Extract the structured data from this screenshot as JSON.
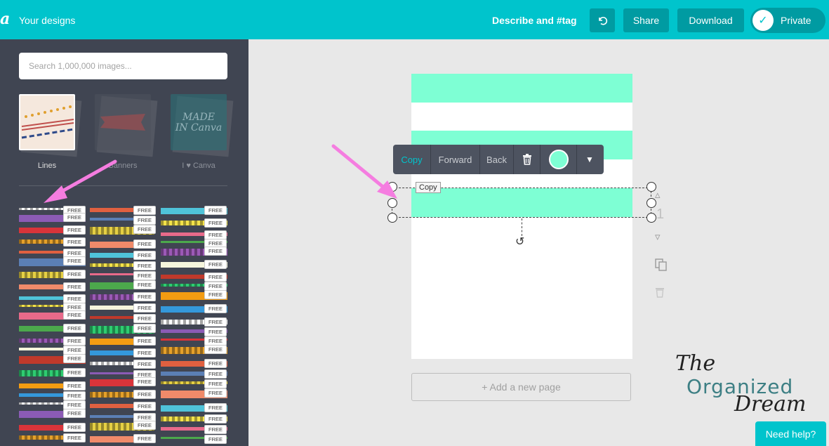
{
  "colors": {
    "brand": "#00c4cc",
    "sidebar": "#404552",
    "accent_shape": "#7effd4",
    "arrow": "#f57de0"
  },
  "header": {
    "logo": "a",
    "your_designs": "Your designs",
    "describe": "Describe and #tag",
    "undo_icon": "undo-icon",
    "share": "Share",
    "download": "Download",
    "private": "Private"
  },
  "sidebar": {
    "search_placeholder": "Search 1,000,000 images...",
    "categories": [
      {
        "label": "Lines",
        "active": true
      },
      {
        "label": "Banners",
        "active": false
      },
      {
        "label": "I ♥ Canva",
        "active": false
      }
    ],
    "canva_thumb": "MADE IN Canva",
    "free_label": "FREE"
  },
  "canvas": {
    "toolbar": {
      "copy": "Copy",
      "forward": "Forward",
      "back": "Back",
      "trash_icon": "trash-icon",
      "color": "#7effd4",
      "chevron_icon": "chevron-down-icon"
    },
    "tooltip": "Copy",
    "page_number": "1",
    "add_page": "+ Add a new page"
  },
  "watermark": {
    "the": "The",
    "organized": "Organized",
    "dream": "Dream"
  },
  "help": "Need help?"
}
